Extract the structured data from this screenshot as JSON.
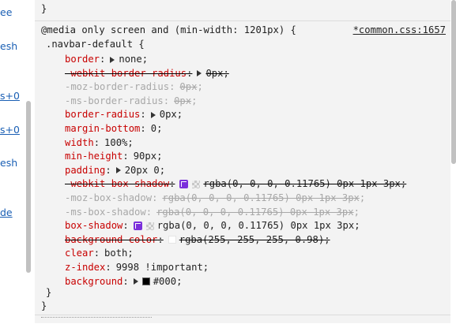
{
  "left_strip": {
    "fragments": [
      {
        "text": "ee",
        "link": false
      },
      {
        "text": "esh",
        "link": false
      },
      {
        "text": "s+0",
        "link": true
      },
      {
        "text": "s+0",
        "link": true
      },
      {
        "text": "esh",
        "link": false
      },
      {
        "text": "de",
        "link": true
      }
    ]
  },
  "styles_pane": {
    "prev_rule_close": "}",
    "media_query": "@media only screen and (min-width: 1201px) {",
    "source": "*common.css:1657",
    "selector": ".navbar-default {",
    "declarations": [
      {
        "prop": "border",
        "value": "none",
        "state": "active",
        "expand": true
      },
      {
        "prop": "-webkit-border-radius",
        "value": "0px",
        "state": "struck",
        "expand": true
      },
      {
        "prop": "-moz-border-radius",
        "value": "0px",
        "state": "inactive-strike-value"
      },
      {
        "prop": "-ms-border-radius",
        "value": "0px",
        "state": "inactive-strike-value"
      },
      {
        "prop": "border-radius",
        "value": "0px",
        "state": "active",
        "expand": true
      },
      {
        "prop": "margin-bottom",
        "value": "0",
        "state": "active"
      },
      {
        "prop": "width",
        "value": "100%",
        "state": "active"
      },
      {
        "prop": "min-height",
        "value": "90px",
        "state": "active"
      },
      {
        "prop": "padding",
        "value": "20px 0",
        "state": "active",
        "expand": true
      },
      {
        "prop": "-webkit-box-shadow",
        "value": "rgba(0, 0, 0, 0.11765) 0px 1px 3px",
        "state": "struck",
        "icons": [
          "shadow",
          "checker"
        ]
      },
      {
        "prop": "-moz-box-shadow",
        "value": "rgba(0, 0, 0, 0.11765) 0px 1px 3px",
        "state": "inactive-strike-value"
      },
      {
        "prop": "-ms-box-shadow",
        "value": "rgba(0, 0, 0, 0.11765) 0px 1px 3px",
        "state": "inactive-strike-value"
      },
      {
        "prop": "box-shadow",
        "value": "rgba(0, 0, 0, 0.11765) 0px 1px 3px",
        "state": "active",
        "icons": [
          "shadow",
          "checker"
        ]
      },
      {
        "prop": "background-color",
        "value": "rgba(255, 255, 255, 0.98)",
        "state": "struck-red",
        "icons": [
          "white"
        ]
      },
      {
        "prop": "clear",
        "value": "both",
        "state": "active"
      },
      {
        "prop": "z-index",
        "value": "9998 !important",
        "state": "active"
      },
      {
        "prop": "background",
        "value": "#000",
        "state": "active",
        "expand": true,
        "icons": [
          "black"
        ]
      }
    ],
    "selector_close": "}",
    "media_close": "}"
  },
  "colors": {
    "property": "#c80000",
    "text": "#222222",
    "inactive": "#a8a8a8",
    "link": "#1a5fb4",
    "shadow_icon": "#7b2fdb"
  }
}
